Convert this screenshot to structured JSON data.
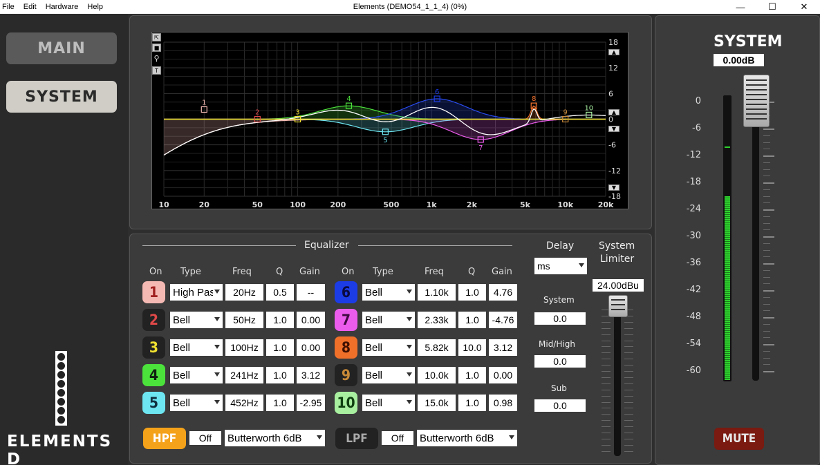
{
  "menu": [
    "File",
    "Edit",
    "Hardware",
    "Help"
  ],
  "window_title": "Elements (DEMO54_1_1_4) (0%)",
  "window_controls": {
    "minimize": "—",
    "maximize": "☐",
    "close": "✕"
  },
  "nav": {
    "main": "MAIN",
    "system": "SYSTEM"
  },
  "logo": "ELEMENTS D",
  "graph": {
    "x_ticks": [
      "10",
      "20",
      "50",
      "100",
      "200",
      "500",
      "1k",
      "2k",
      "5k",
      "10k",
      "20k"
    ],
    "y_ticks": [
      "18",
      "12",
      "6",
      "0",
      "-6",
      "-12",
      "-18"
    ],
    "markers": [
      "1",
      "2",
      "3",
      "4",
      "5",
      "6",
      "7",
      "8",
      "9",
      "10"
    ]
  },
  "eq": {
    "title": "Equalizer",
    "headers": {
      "on": "On",
      "type": "Type",
      "freq": "Freq",
      "q": "Q",
      "gain": "Gain"
    },
    "bands": [
      {
        "num": "1",
        "type": "High Pass",
        "freq": "20Hz",
        "q": "0.5",
        "gain": "--",
        "color": "#f5b9b3",
        "text": "#a02020"
      },
      {
        "num": "2",
        "type": "Bell",
        "freq": "50Hz",
        "q": "1.0",
        "gain": "0.00",
        "color": "#222222",
        "text": "#e04848"
      },
      {
        "num": "3",
        "type": "Bell",
        "freq": "100Hz",
        "q": "1.0",
        "gain": "0.00",
        "color": "#222222",
        "text": "#f0e030"
      },
      {
        "num": "4",
        "type": "Bell",
        "freq": "241Hz",
        "q": "1.0",
        "gain": "3.12",
        "color": "#4ce23c",
        "text": "#102010"
      },
      {
        "num": "5",
        "type": "Bell",
        "freq": "452Hz",
        "q": "1.0",
        "gain": "-2.95",
        "color": "#6ee6f2",
        "text": "#103040"
      },
      {
        "num": "6",
        "type": "Bell",
        "freq": "1.10k",
        "q": "1.0",
        "gain": "4.76",
        "color": "#1c3ce6",
        "text": "#0a0a40"
      },
      {
        "num": "7",
        "type": "Bell",
        "freq": "2.33k",
        "q": "1.0",
        "gain": "-4.76",
        "color": "#ec5cec",
        "text": "#400a40"
      },
      {
        "num": "8",
        "type": "Bell",
        "freq": "5.82k",
        "q": "10.0",
        "gain": "3.12",
        "color": "#f0702a",
        "text": "#401000"
      },
      {
        "num": "9",
        "type": "Bell",
        "freq": "10.0k",
        "q": "1.0",
        "gain": "0.00",
        "color": "#222222",
        "text": "#c88a38"
      },
      {
        "num": "10",
        "type": "Bell",
        "freq": "15.0k",
        "q": "1.0",
        "gain": "0.98",
        "color": "#a8f0a0",
        "text": "#104010"
      }
    ],
    "hpf": {
      "label": "HPF",
      "state": "Off",
      "type": "Butterworth 6dB"
    },
    "lpf": {
      "label": "LPF",
      "state": "Off",
      "type": "Butterworth 6dB"
    }
  },
  "delay": {
    "title": "Delay",
    "unit": "ms",
    "system_label": "System",
    "system_value": "0.0",
    "midhigh_label": "Mid/High",
    "midhigh_value": "0.0",
    "sub_label": "Sub",
    "sub_value": "0.0"
  },
  "limiter": {
    "title_line1": "System",
    "title_line2": "Limiter",
    "value": "24.00dBu"
  },
  "system": {
    "title": "SYSTEM",
    "gain": "0.00dB",
    "scale": [
      "0",
      "-6",
      "-12",
      "-18",
      "-24",
      "-30",
      "-36",
      "-42",
      "-48",
      "-54",
      "-60"
    ],
    "meter_level_db": -21,
    "peak_db": -10,
    "mute": "MUTE"
  }
}
